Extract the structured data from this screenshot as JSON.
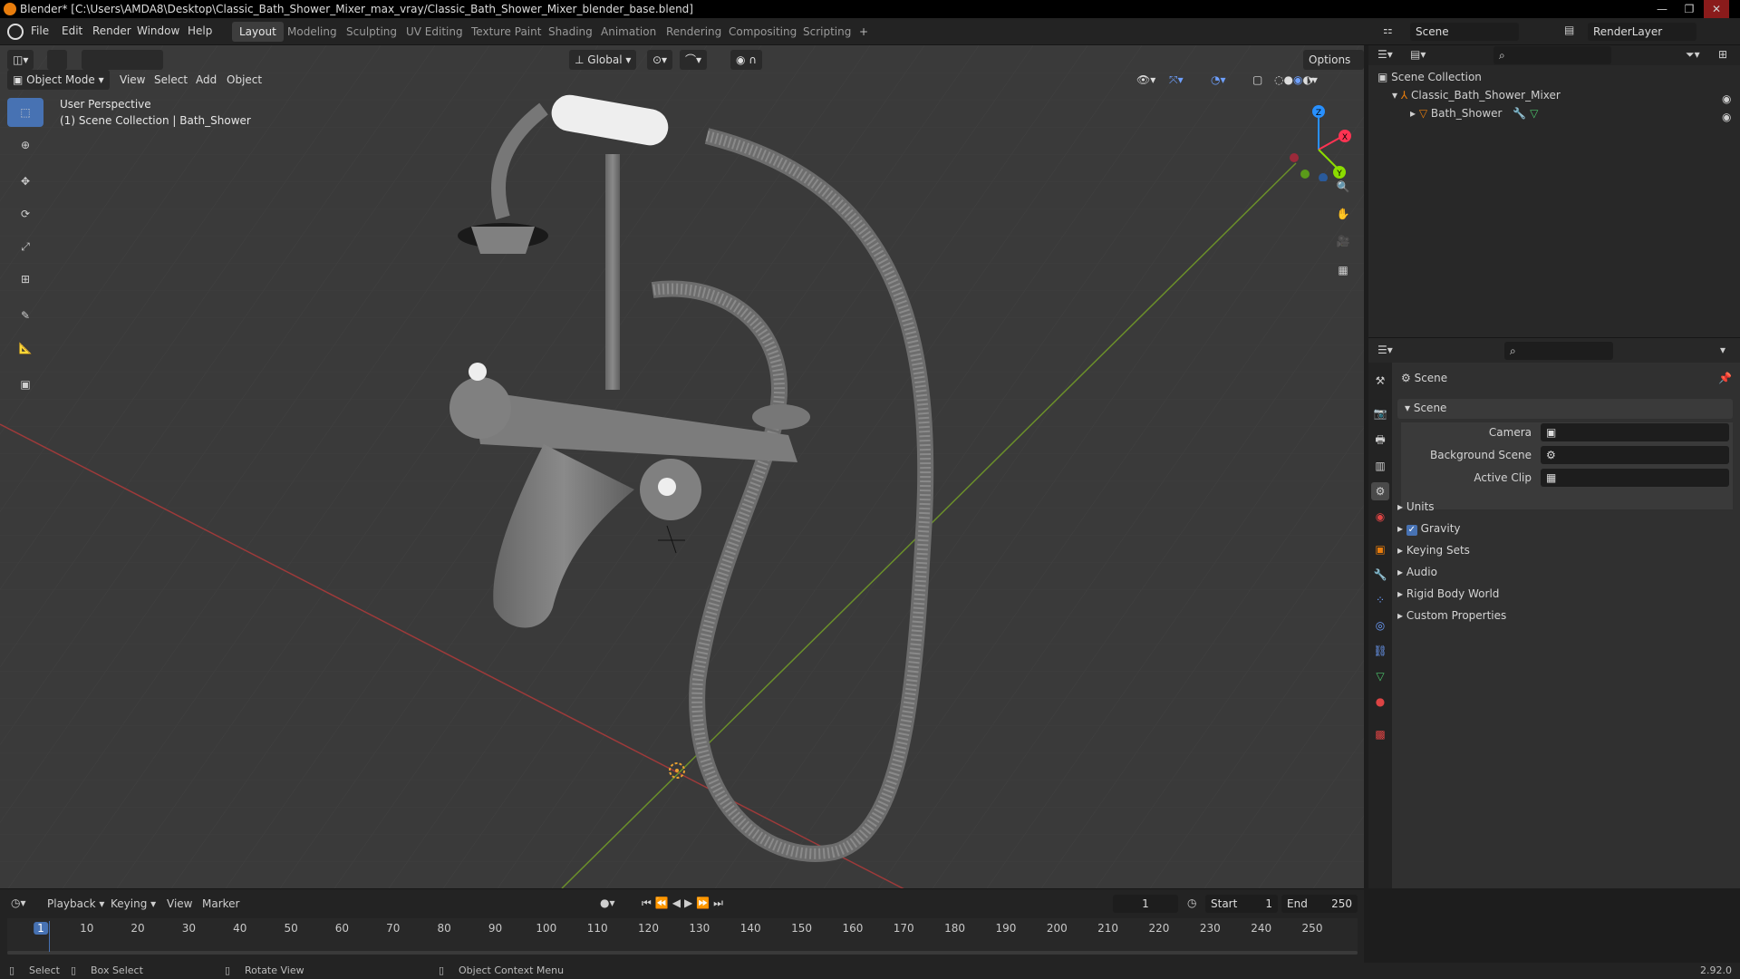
{
  "window": {
    "title": "Blender* [C:\\Users\\AMDA8\\Desktop\\Classic_Bath_Shower_Mixer_max_vray/Classic_Bath_Shower_Mixer_blender_base.blend]",
    "minimize": "—",
    "maximize": "❐",
    "close": "✕"
  },
  "menu": [
    "File",
    "Edit",
    "Render",
    "Window",
    "Help"
  ],
  "workspaces": [
    "Layout",
    "Modeling",
    "Sculpting",
    "UV Editing",
    "Texture Paint",
    "Shading",
    "Animation",
    "Rendering",
    "Compositing",
    "Scripting"
  ],
  "active_workspace": "Layout",
  "add_workspace": "+",
  "scene_name": "Scene",
  "view_layer": "RenderLayer",
  "viewport": {
    "mode": "Object Mode",
    "menus": [
      "View",
      "Select",
      "Add",
      "Object"
    ],
    "transform_orientation": "Global",
    "options": "Options",
    "overlay_title": "User Perspective",
    "overlay_subtitle": "(1) Scene Collection | Bath_Shower"
  },
  "gizmo": {
    "x": "X",
    "y": "Y",
    "z": "Z"
  },
  "outliner": {
    "root": "Scene Collection",
    "items": [
      {
        "label": "Classic_Bath_Shower_Mixer"
      },
      {
        "label": "Bath_Shower"
      }
    ]
  },
  "properties": {
    "header": "Scene",
    "panel": "Scene",
    "fields": [
      {
        "label": "Camera"
      },
      {
        "label": "Background Scene"
      },
      {
        "label": "Active Clip"
      }
    ],
    "sections": [
      "Units",
      "Gravity",
      "Keying Sets",
      "Audio",
      "Rigid Body World",
      "Custom Properties"
    ],
    "gravity_enabled": true
  },
  "timeline": {
    "menus": [
      "Playback",
      "Keying",
      "View",
      "Marker"
    ],
    "current_frame": "1",
    "start_label": "Start",
    "start": "1",
    "end_label": "End",
    "end": "250",
    "ticks": [
      "1",
      "10",
      "20",
      "30",
      "40",
      "50",
      "60",
      "70",
      "80",
      "90",
      "100",
      "110",
      "120",
      "130",
      "140",
      "150",
      "160",
      "170",
      "180",
      "190",
      "200",
      "210",
      "220",
      "230",
      "240",
      "250"
    ]
  },
  "statusbar": {
    "select": "Select",
    "box_select": "Box Select",
    "rotate_view": "Rotate View",
    "context_menu": "Object Context Menu",
    "version": "2.92.0"
  },
  "colors": {
    "accent": "#4772b3",
    "x_axis": "#ff3352",
    "y_axis": "#8bdc00",
    "z_axis": "#2890ff",
    "object_orange": "#e87d0d"
  }
}
